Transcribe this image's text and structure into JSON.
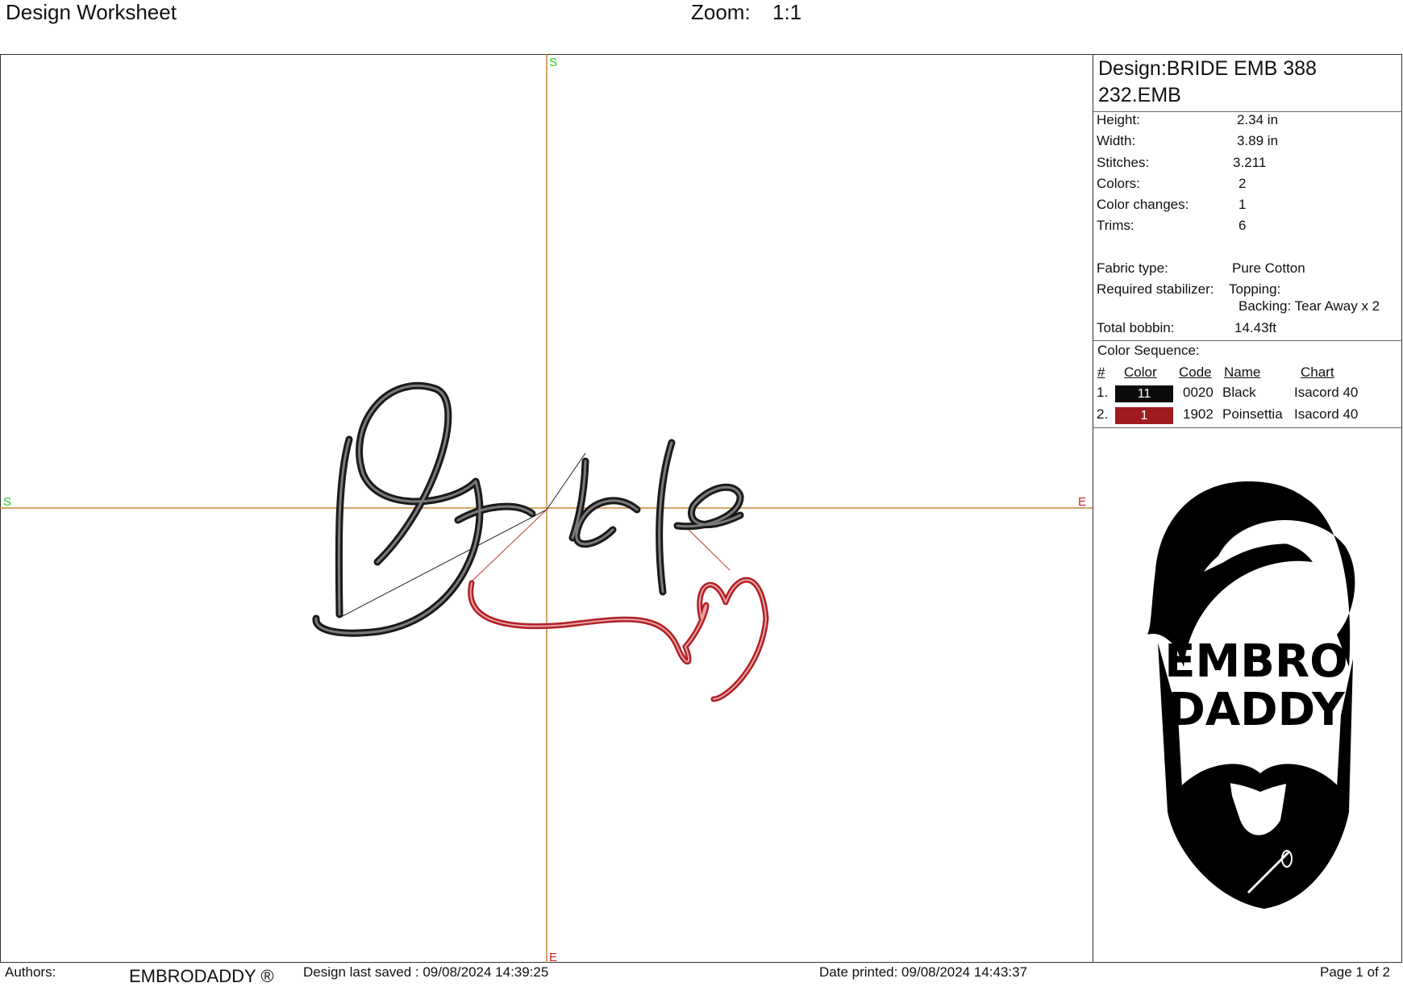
{
  "window": {
    "title": "Design Worksheet",
    "zoom_label": "Zoom:",
    "zoom_value": "1:1"
  },
  "canvas": {
    "center_markers": {
      "top": "S",
      "left": "S",
      "right": "E",
      "bottom": "E"
    },
    "marker_colors": {
      "start": "#22cc22",
      "end": "#cc2222"
    },
    "crosshair_color": "#c8893a",
    "design_text": "Bride",
    "thread_colors": {
      "black": "#1a1a1a",
      "red": "#b02026"
    }
  },
  "info": {
    "design_name": "Design:BRIDE EMB 388 232.EMB",
    "specs": [
      {
        "label": "Height:",
        "value": "2.34 in"
      },
      {
        "label": "Width:",
        "value": "3.89 in"
      },
      {
        "label": "Stitches:",
        "value": "3.211"
      },
      {
        "label": "Colors:",
        "value": "2"
      },
      {
        "label": "Color changes:",
        "value": "1"
      },
      {
        "label": "Trims:",
        "value": "6"
      }
    ],
    "fabric_label": "Fabric type:",
    "fabric_value": "Pure Cotton",
    "stabilizer_label": "Required stabilizer:",
    "stabilizer_topping": "Topping:",
    "stabilizer_backing": "Backing: Tear Away x 2",
    "bobbin_label": "Total bobbin:",
    "bobbin_value": "14.43ft",
    "sequence_title": "Color Sequence:",
    "sequence_headers": {
      "num": "#",
      "color": "Color",
      "code": "Code",
      "name": "Name",
      "chart": "Chart"
    },
    "sequence": [
      {
        "num": "1.",
        "swatch": "11",
        "swatch_color": "#0b0b0b",
        "code": "0020",
        "name": "Black",
        "chart": "Isacord 40"
      },
      {
        "num": "2.",
        "swatch": "1",
        "swatch_color": "#a01b1f",
        "code": "1902",
        "name": "Poinsettia",
        "chart": "Isacord 40"
      }
    ]
  },
  "logo": {
    "line1": "EMBRO",
    "line2": "DADDY"
  },
  "footer": {
    "authors_label": "Authors:",
    "author": "EMBRODADDY ®",
    "last_saved": "Design last saved : 09/08/2024 14:39:25",
    "printed": "Date printed: 09/08/2024 14:43:37",
    "page": "Page 1 of 2"
  }
}
